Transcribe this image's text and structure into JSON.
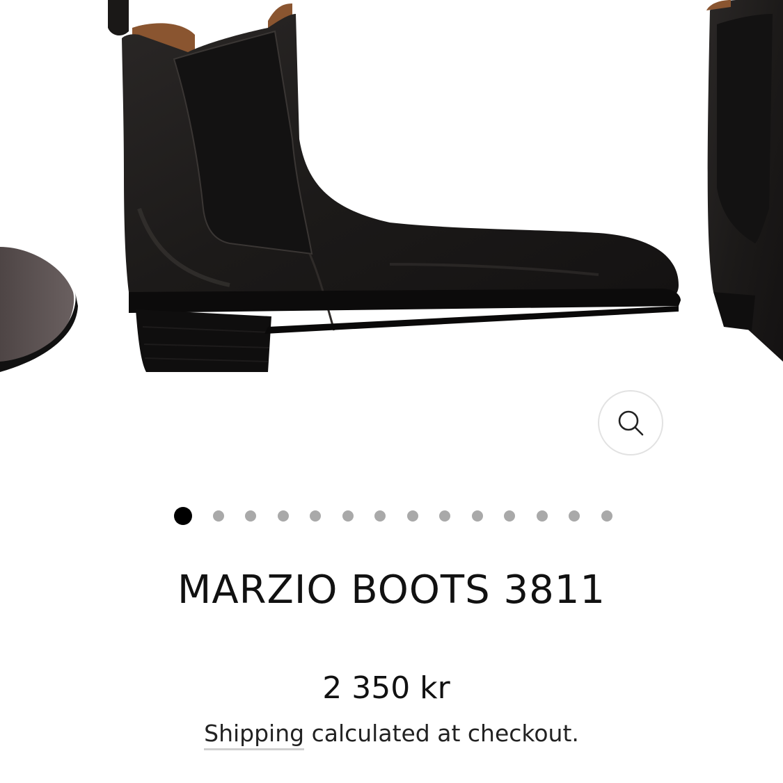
{
  "product": {
    "title": "MARZIO BOOTS 3811",
    "price": "2 350 kr",
    "shipping_link": "Shipping",
    "shipping_rest": " calculated at checkout."
  },
  "gallery": {
    "slide_count": 14,
    "active_index": 0,
    "zoom_icon": "search-icon",
    "colors": {
      "boot_leather": "#1c1a19",
      "boot_elastic": "#141313",
      "suede_prev": "#5a5050",
      "lining": "#8a5530",
      "dot_active": "#000000",
      "dot_inactive": "#a9a9a9"
    }
  }
}
